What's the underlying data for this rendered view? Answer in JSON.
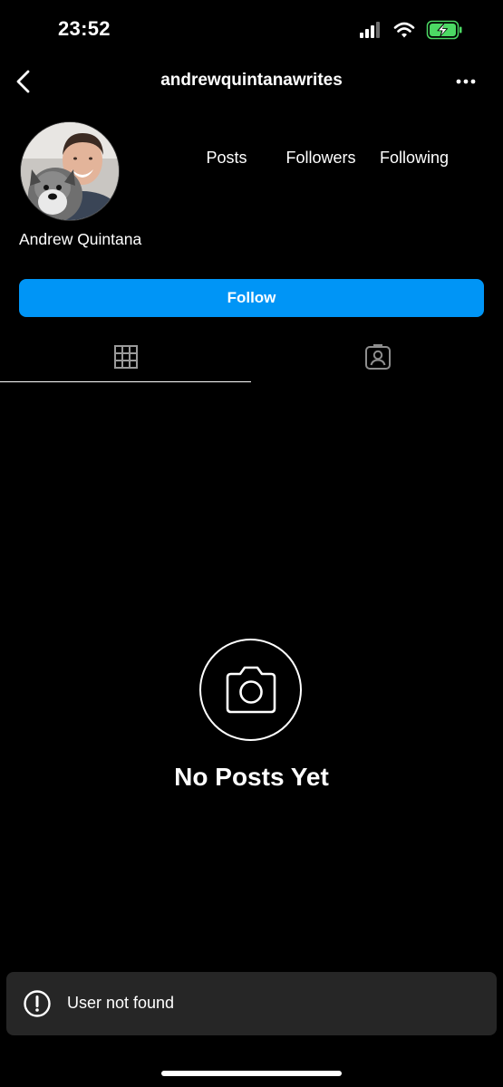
{
  "status_bar": {
    "time": "23:52",
    "icons": [
      "signal-icon",
      "wifi-icon",
      "battery-charging-icon"
    ],
    "battery_color": "#4cd964"
  },
  "header": {
    "username": "andrewquintanawrites",
    "icons": [
      "chevron-left-icon",
      "more-horizontal-icon"
    ]
  },
  "profile": {
    "display_name": "Andrew Quintana",
    "stats": {
      "posts_label": "Posts",
      "followers_label": "Followers",
      "following_label": "Following"
    },
    "follow_label": "Follow"
  },
  "tabs": {
    "grid_icon": "grid-icon",
    "tagged_icon": "tagged-person-icon",
    "active": "grid"
  },
  "empty_state": {
    "icon": "camera-icon",
    "title": "No Posts Yet"
  },
  "toast": {
    "icon": "alert-circle-icon",
    "message": "User not found"
  },
  "colors": {
    "background": "#000000",
    "accent": "#0095f6",
    "toast_background": "#262626",
    "muted_icon": "#8e8e8e"
  }
}
